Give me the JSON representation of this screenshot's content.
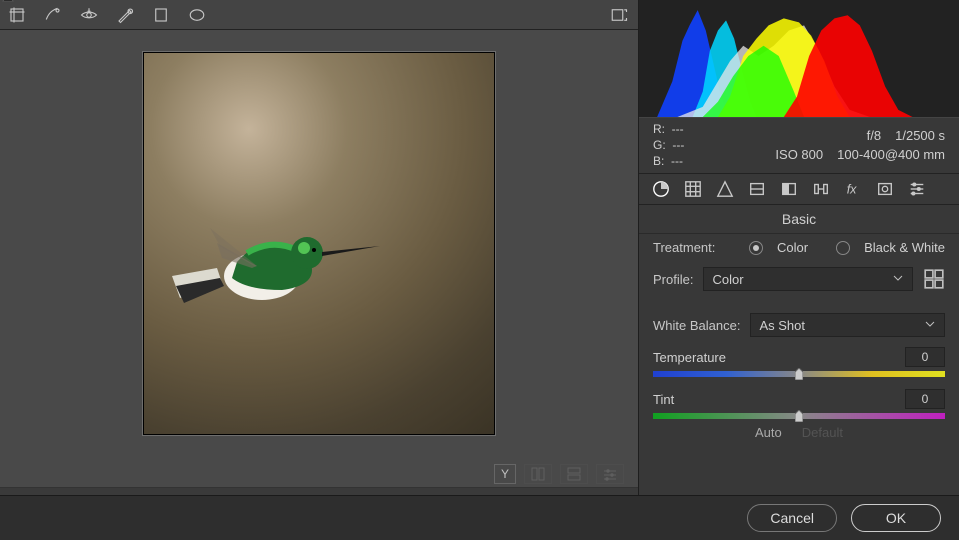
{
  "metadata": {
    "rgb": {
      "r_label": "R:",
      "g_label": "G:",
      "b_label": "B:",
      "r_val": "---",
      "g_val": "---",
      "b_val": "---"
    },
    "aperture": "f/8",
    "shutter": "1/2500 s",
    "iso": "ISO 800",
    "lens": "100-400@400 mm"
  },
  "panel_title": "Basic",
  "treatment": {
    "label": "Treatment:",
    "color_label": "Color",
    "bw_label": "Black & White",
    "selected": "color"
  },
  "profile": {
    "label": "Profile:",
    "value": "Color"
  },
  "white_balance": {
    "label": "White Balance:",
    "value": "As Shot"
  },
  "temperature": {
    "label": "Temperature",
    "value": "0"
  },
  "tint": {
    "label": "Tint",
    "value": "0"
  },
  "auto_default": {
    "auto": "Auto",
    "default": "Default"
  },
  "footer": {
    "cancel": "Cancel",
    "ok": "OK"
  },
  "before_after_toggle": "Y"
}
